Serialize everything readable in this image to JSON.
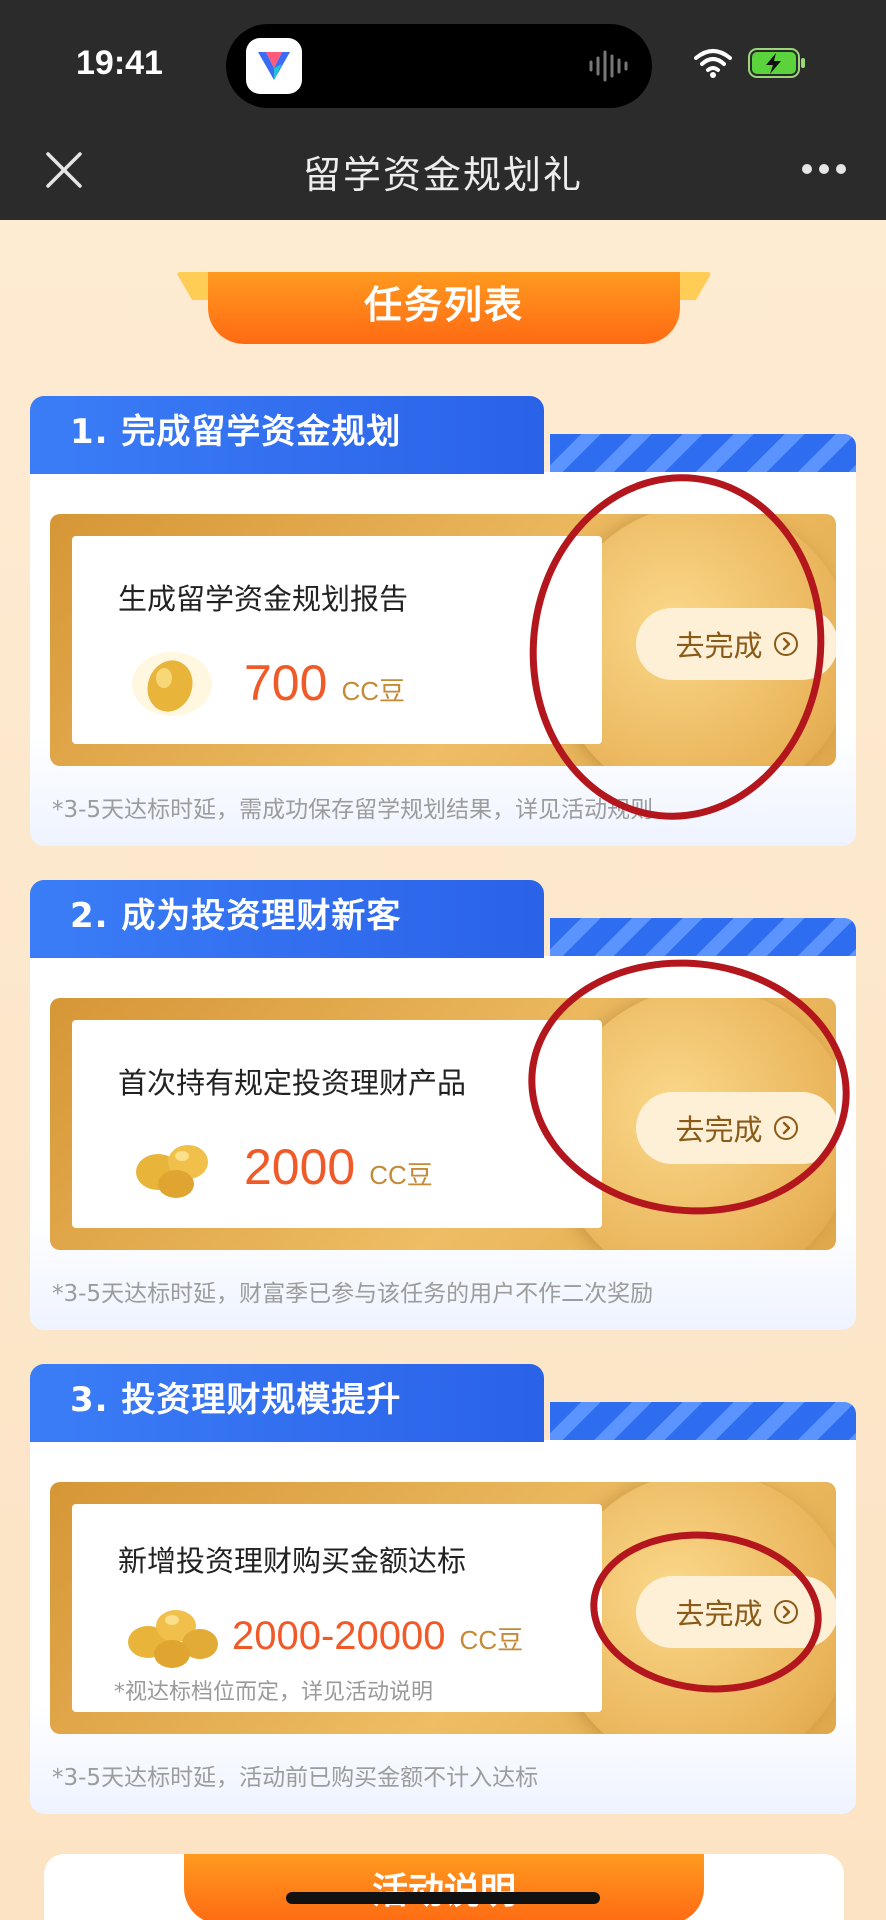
{
  "status": {
    "time": "19:41"
  },
  "nav": {
    "title": "留学资金规划礼"
  },
  "banner": {
    "label": "任务列表"
  },
  "tasks": [
    {
      "title": "1. 完成留学资金规划",
      "desc": "生成留学资金规划报告",
      "points": "700",
      "unit": "CC豆",
      "sub_note": "",
      "button": "去完成",
      "footnote": "*3-5天达标时延，需成功保存留学规划结果，详见活动规则"
    },
    {
      "title": "2. 成为投资理财新客",
      "desc": "首次持有规定投资理财产品",
      "points": "2000",
      "unit": "CC豆",
      "sub_note": "",
      "button": "去完成",
      "footnote": "*3-5天达标时延，财富季已参与该任务的用户不作二次奖励"
    },
    {
      "title": "3. 投资理财规模提升",
      "desc": "新增投资理财购买金额达标",
      "points": "2000-20000",
      "unit": "CC豆",
      "sub_note": "*视达标档位而定，详见活动说明",
      "button": "去完成",
      "footnote": "*3-5天达标时延，活动前已购买金额不计入达标"
    }
  ],
  "activity": {
    "label": "活动说明"
  },
  "colors": {
    "accent_orange": "#ff6a13",
    "header_blue": "#2a62e8",
    "points_red": "#f05a28",
    "annotation_red": "#b3161c"
  },
  "icons": [
    "close-icon",
    "more-icon",
    "wifi-icon",
    "battery-charging-icon",
    "bean-icon",
    "chevron-right-circle-icon"
  ]
}
